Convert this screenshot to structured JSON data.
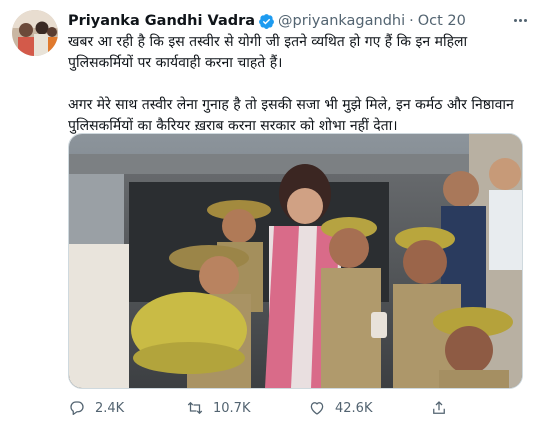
{
  "tweet": {
    "author_name": "Priyanka Gandhi Vadra",
    "handle": "@priyankagandhi",
    "separator": "·",
    "date": "Oct 20",
    "verified_icon": "verified-badge-icon",
    "paragraph_1": "खबर आ रही है कि इस तस्वीर से योगी जी इतने व्यथित हो गए हैं कि इन महिला पुलिसकर्मियों पर कार्यवाही करना चाहते हैं।",
    "paragraph_2": "अगर मेरे साथ तस्वीर लेना गुनाह है तो इसकी सजा भी मुझे मिले, इन कर्मठ और निष्ठावान पुलिसकर्मियों का कैरियर ख़राब करना सरकार को शोभा नहीं देता।",
    "accent_color": "#1d9bf0"
  },
  "actions": {
    "reply_count": "2.4K",
    "retweet_count": "10.7K",
    "like_count": "42.6K",
    "reply_icon": "reply-icon",
    "retweet_icon": "retweet-icon",
    "like_icon": "heart-icon",
    "share_icon": "share-icon"
  }
}
